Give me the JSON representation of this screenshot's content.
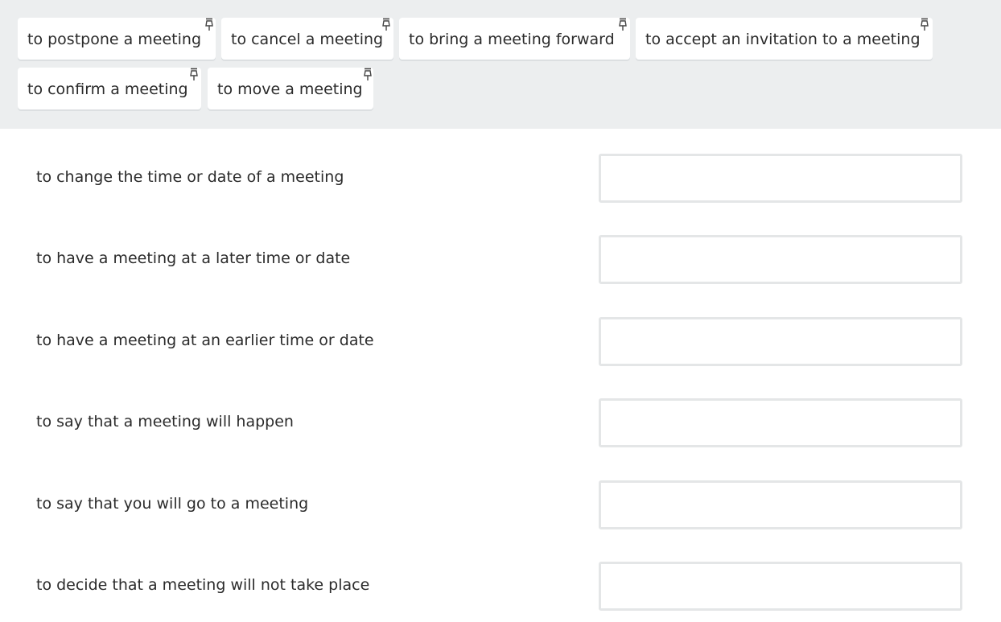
{
  "chips": [
    {
      "label": "to postpone a meeting"
    },
    {
      "label": "to cancel a meeting"
    },
    {
      "label": "to bring a meeting forward"
    },
    {
      "label": "to accept an invitation to a meeting"
    },
    {
      "label": "to confirm a meeting"
    },
    {
      "label": "to move a meeting"
    }
  ],
  "chip_icon": "pin-icon",
  "definitions": [
    {
      "text": "to change the time or date of a meeting",
      "answer": ""
    },
    {
      "text": "to have a meeting at a later time or date",
      "answer": ""
    },
    {
      "text": "to have a meeting at an earlier time or date",
      "answer": ""
    },
    {
      "text": "to say that a meeting will happen",
      "answer": ""
    },
    {
      "text": "to say that you will go to a meeting",
      "answer": ""
    },
    {
      "text": "to decide that a meeting will not take place",
      "answer": ""
    }
  ],
  "colors": {
    "bank_background": "#eceeef",
    "chip_background": "#ffffff",
    "drop_border": "#e4e6e7",
    "text": "#2b2b2b"
  }
}
